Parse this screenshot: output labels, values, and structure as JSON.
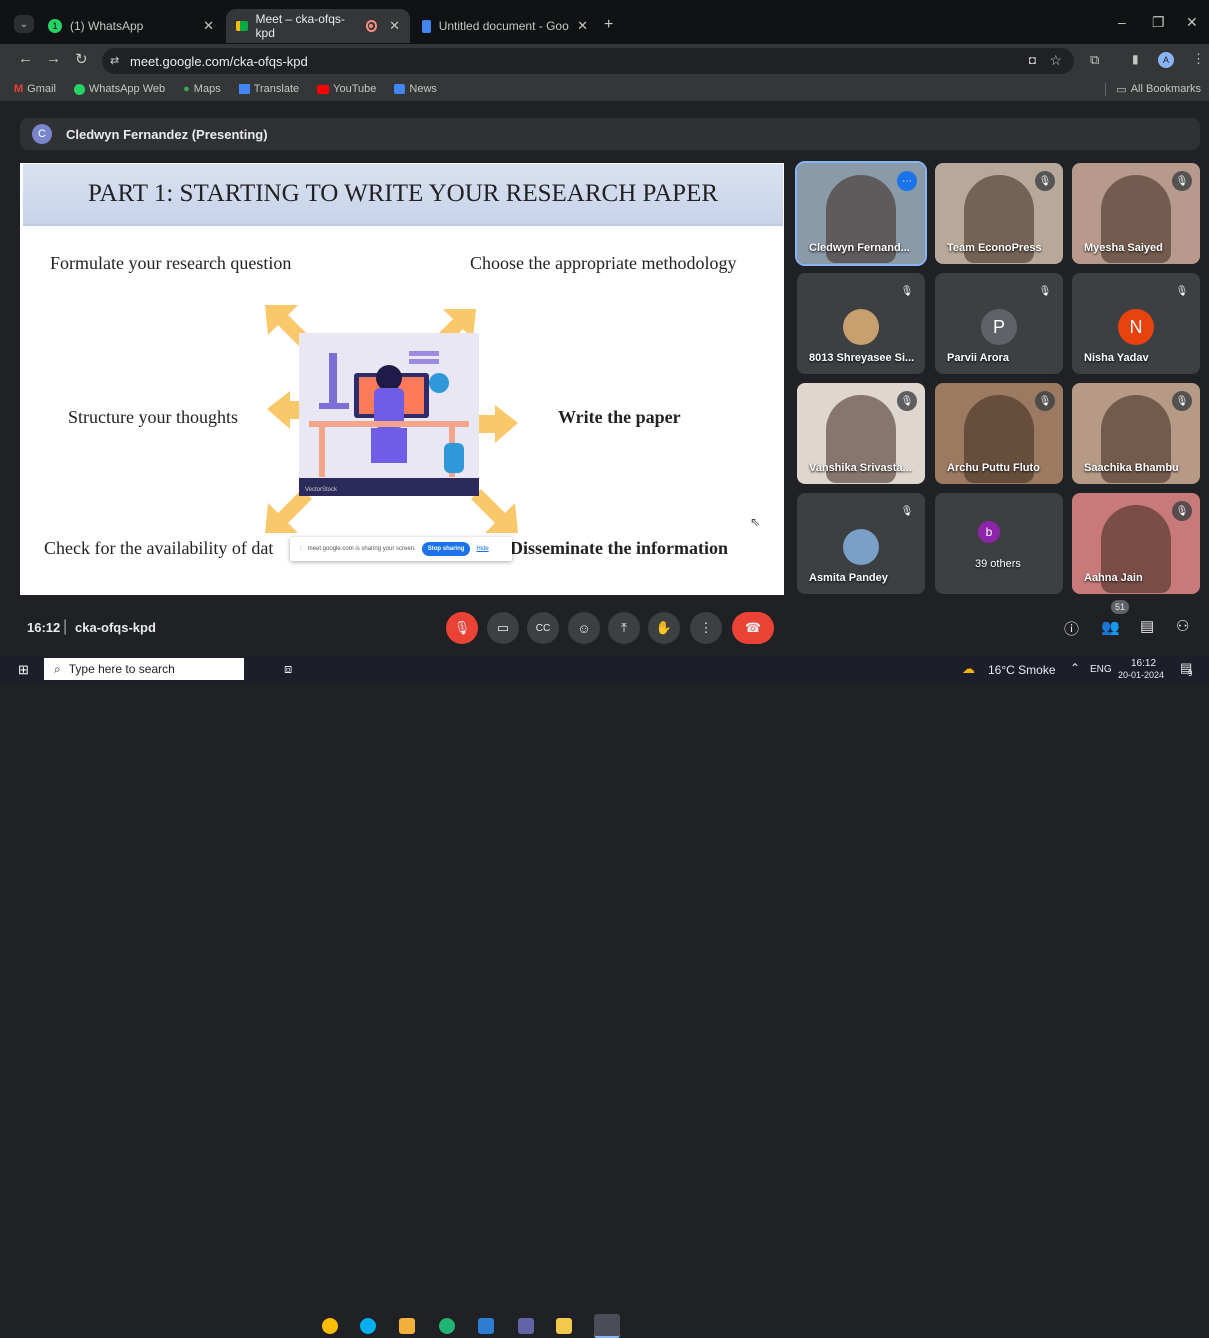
{
  "browser": {
    "tabs": [
      {
        "label": "(1) WhatsApp",
        "active": false
      },
      {
        "label": "Meet – cka-ofqs-kpd",
        "active": true
      },
      {
        "label": "Untitled document - Google Do",
        "active": false
      }
    ],
    "url": "meet.google.com/cka-ofqs-kpd",
    "bookmarks": [
      "Gmail",
      "WhatsApp Web",
      "Maps",
      "Translate",
      "YouTube",
      "News"
    ],
    "all_bookmarks": "All Bookmarks",
    "profile_initial": "A"
  },
  "meet": {
    "presenter_initial": "C",
    "presenting_label": "Cledwyn Fernandez (Presenting)",
    "slide": {
      "title": "PART 1: STARTING TO WRITE YOUR RESEARCH PAPER",
      "items": {
        "top_left": "Formulate your research question",
        "top_right": "Choose the appropriate methodology",
        "mid_left": "Structure your thoughts",
        "mid_right": "Write the paper",
        "bottom_left": "Check for the availability of dat",
        "bottom_right": "Disseminate the information"
      },
      "image_brand": "VectorStock"
    },
    "share_popup": {
      "text": "meet.google.com is sharing your screen.",
      "stop": "Stop sharing",
      "hide": "Hide"
    },
    "participants": [
      {
        "name": "Cledwyn Fernand...",
        "kind": "video",
        "color": "#8a9aa8"
      },
      {
        "name": "Team EconoPress",
        "kind": "video",
        "color": "#b7a89a"
      },
      {
        "name": "Myesha Saiyed",
        "kind": "video",
        "color": "#b89a8c"
      },
      {
        "name": "8013 Shreyasee Si...",
        "kind": "photo",
        "color": "#c8a070"
      },
      {
        "name": "Parvii Arora",
        "kind": "initial",
        "initial": "P",
        "color": "#5f6368"
      },
      {
        "name": "Nisha Yadav",
        "kind": "initial",
        "initial": "N",
        "color": "#e8430e"
      },
      {
        "name": "Vanshika Srivasta...",
        "kind": "video",
        "color": "#e0d6d0"
      },
      {
        "name": "Archu Puttu Fluto",
        "kind": "video",
        "color": "#9c7a62"
      },
      {
        "name": "Saachika Bhambu",
        "kind": "video",
        "color": "#b69a86"
      },
      {
        "name": "Asmita Pandey",
        "kind": "photo",
        "color": "#7aa0c8"
      },
      {
        "name": "39 others",
        "kind": "others",
        "initial": "b",
        "color": "#8e24aa"
      },
      {
        "name": "Aahna Jain",
        "kind": "video",
        "color": "#c87a7a"
      }
    ],
    "time": "16:12",
    "meeting_code": "cka-ofqs-kpd",
    "people_count": "51"
  },
  "taskbar": {
    "search_placeholder": "Type here to search",
    "weather": "16°C Smoke",
    "lang": "ENG",
    "clock_time": "16:12",
    "clock_date": "20-01-2024",
    "notif_count": "9"
  }
}
